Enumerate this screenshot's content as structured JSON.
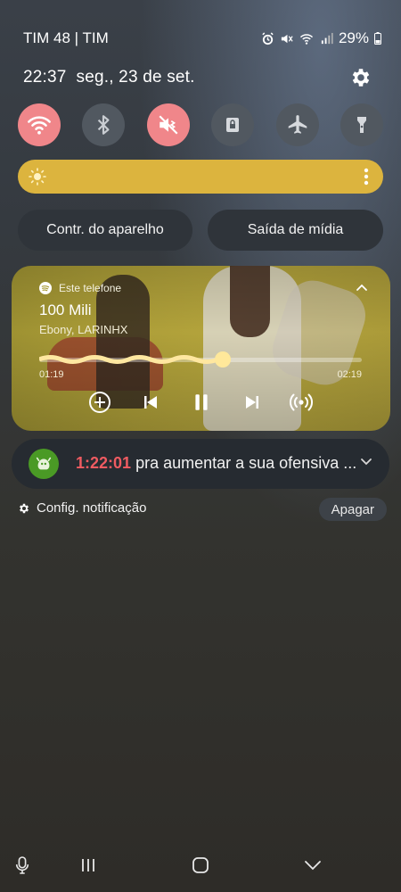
{
  "status": {
    "carrier": "TIM 48 | TIM",
    "battery": "29%",
    "icons": [
      "alarm-icon",
      "mute-icon",
      "wifi-icon",
      "signal-icon",
      "battery-icon"
    ]
  },
  "header": {
    "time": "22:37",
    "date": "seg., 23 de set."
  },
  "quick_settings": [
    {
      "name": "wifi",
      "icon": "wifi-icon",
      "on": true
    },
    {
      "name": "bluetooth",
      "icon": "bluetooth-icon",
      "on": false
    },
    {
      "name": "mute",
      "icon": "mute-icon",
      "on": true
    },
    {
      "name": "rotation-lock",
      "icon": "lock-icon",
      "on": false
    },
    {
      "name": "airplane",
      "icon": "airplane-icon",
      "on": false
    },
    {
      "name": "flashlight",
      "icon": "flashlight-icon",
      "on": false
    }
  ],
  "brightness": {
    "level": 1.0,
    "color": "#dcb43e"
  },
  "buttons": {
    "device_control": "Contr. do aparelho",
    "media_output": "Saída de mídia"
  },
  "media": {
    "source": "Este telefone",
    "title": "100 Mili",
    "artist": "Ebony, LARINHX",
    "elapsed": "01:19",
    "duration": "02:19",
    "progress": 0.57
  },
  "notification": {
    "timer": "1:22:01",
    "text": "pra aumentar a sua ofensiva ...",
    "icon": "duolingo-icon",
    "accent": "#ef5b61"
  },
  "footer": {
    "settings_label": "Config. notificação",
    "clear_label": "Apagar"
  },
  "navigation": [
    "mic-icon",
    "recents-icon",
    "home-icon",
    "hide-keyboard-icon"
  ]
}
